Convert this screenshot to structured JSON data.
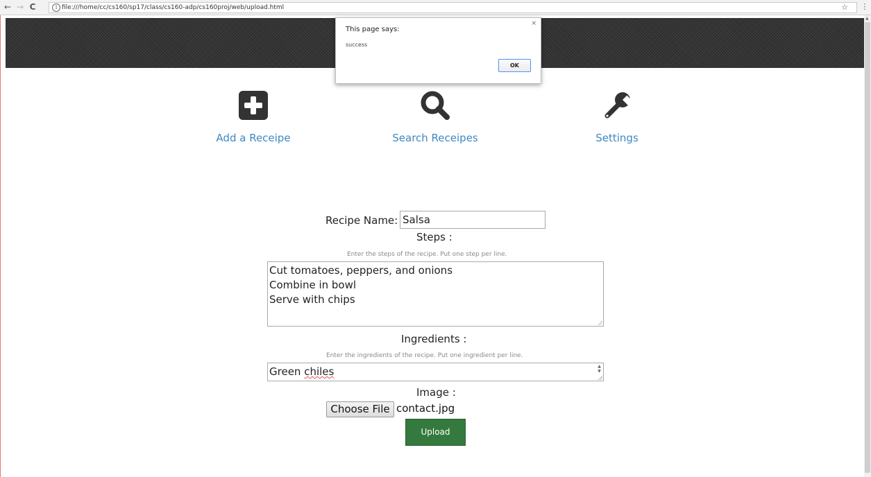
{
  "browser": {
    "url": "file:///home/cc/cs160/sp17/class/cs160-adp/cs160proj/web/upload.html",
    "back_glyph": "←",
    "forward_glyph": "→",
    "reload_glyph": "C",
    "info_glyph": "i",
    "star_glyph": "☆",
    "menu_glyph": "⋮"
  },
  "nav": {
    "items": [
      {
        "label": "Add a Receipe",
        "icon": "plus-square-icon"
      },
      {
        "label": "Search Receipes",
        "icon": "search-icon"
      },
      {
        "label": "Settings",
        "icon": "wrench-icon"
      }
    ],
    "link_color": "#3d89c4"
  },
  "form": {
    "recipe_name_label": "Recipe Name:",
    "recipe_name_value": "Salsa",
    "steps_label": "Steps :",
    "steps_hint": "Enter the steps of the recipe. Put one step per line.",
    "steps_lines": [
      "Cut tomatoes, peppers, and onions",
      "Combine in bowl",
      "Serve with chips"
    ],
    "ingredients_label": "Ingredients :",
    "ingredients_hint": "Enter the ingredients of the recipe. Put one ingredient per line.",
    "ingredients_word1": "Green",
    "ingredients_word2": "chiles",
    "image_label": "Image :",
    "choose_file_label": "Choose File",
    "file_name": "contact.jpg",
    "upload_label": "Upload",
    "upload_color": "#347a3e"
  },
  "alert": {
    "title": "This page says:",
    "message": "success",
    "ok_label": "OK",
    "close_glyph": "×"
  }
}
